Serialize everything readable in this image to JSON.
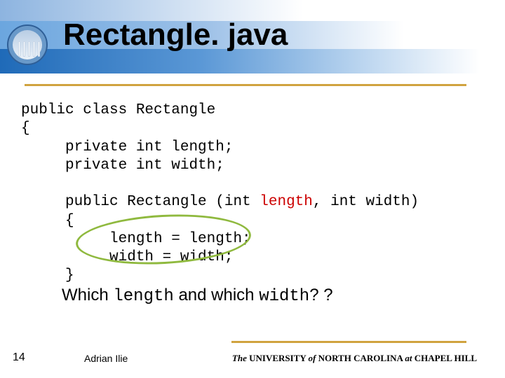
{
  "title": "Rectangle. java",
  "code": {
    "l1": "public class Rectangle",
    "l2": "{",
    "l3": "     private int length;",
    "l4": "     private int width;",
    "l5": "     public Rectangle (int ",
    "l5r": "length",
    "l5b": ", int width)",
    "l6": "     {",
    "l7": "          length = length;",
    "l8": "          width = width;",
    "l9": "     }"
  },
  "question": {
    "w1": "Which ",
    "m1": "length",
    "w2": " and which ",
    "m2": "width",
    "w3": "? ?"
  },
  "footer": {
    "page": "14",
    "author": "Adrian Ilie",
    "univ_the": "The ",
    "univ_u": "UNIVERSITY ",
    "univ_of": "of ",
    "univ_nc": "NORTH CAROLINA ",
    "univ_at": "at ",
    "univ_ch": "CHAPEL HILL"
  }
}
